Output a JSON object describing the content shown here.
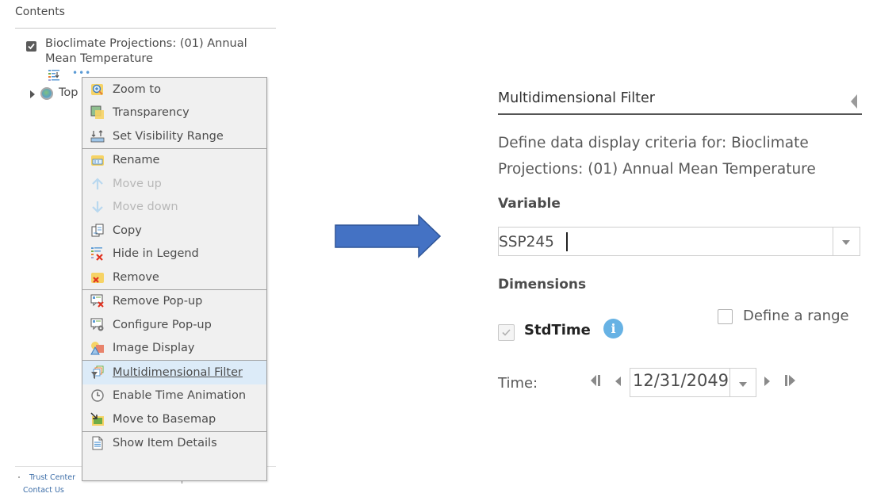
{
  "contents_panel": {
    "title": "Contents",
    "layers": [
      {
        "title": "Bioclimate Projections: (01) Annual Mean Temperature",
        "checked": true,
        "icons": [
          "legend-icon",
          "more-options-icon"
        ]
      },
      {
        "title": "Top",
        "expandable": true,
        "icon": "basemap-globe-icon"
      }
    ],
    "footer": {
      "trust_center": "Trust Center",
      "contact_us": "Contact Us"
    }
  },
  "context_menu": {
    "groups": [
      [
        {
          "label": "Zoom to",
          "icon": "zoom-to-icon",
          "disabled": false
        },
        {
          "label": "Transparency",
          "icon": "transparency-icon",
          "disabled": false
        },
        {
          "label": "Set Visibility Range",
          "icon": "visibility-range-icon",
          "disabled": false
        }
      ],
      [
        {
          "label": "Rename",
          "icon": "rename-icon",
          "disabled": false
        },
        {
          "label": "Move up",
          "icon": "arrow-up-icon",
          "disabled": true
        },
        {
          "label": "Move down",
          "icon": "arrow-down-icon",
          "disabled": true
        },
        {
          "label": "Copy",
          "icon": "copy-icon",
          "disabled": false
        },
        {
          "label": "Hide in Legend",
          "icon": "hide-legend-icon",
          "disabled": false
        },
        {
          "label": "Remove",
          "icon": "remove-icon",
          "disabled": false
        }
      ],
      [
        {
          "label": "Remove Pop-up",
          "icon": "remove-popup-icon",
          "disabled": false
        },
        {
          "label": "Configure Pop-up",
          "icon": "configure-popup-icon",
          "disabled": false
        },
        {
          "label": "Image Display",
          "icon": "image-display-icon",
          "disabled": false
        }
      ],
      [
        {
          "label": "Multidimensional Filter",
          "icon": "multidimensional-filter-icon",
          "disabled": false,
          "active": true
        },
        {
          "label": "Enable Time Animation",
          "icon": "clock-icon",
          "disabled": false
        },
        {
          "label": "Move to Basemap",
          "icon": "move-to-basemap-icon",
          "disabled": false
        }
      ],
      [
        {
          "label": "Show Item Details",
          "icon": "item-details-icon",
          "disabled": false
        }
      ]
    ]
  },
  "arrow": {
    "icon": "right-arrow-icon",
    "color": "#4472c4"
  },
  "filter_panel": {
    "title": "Multidimensional Filter",
    "description": "Define data display criteria for: Bioclimate Projections: (01) Annual Mean Temperature",
    "variable_label": "Variable",
    "variable_value": "SSP245",
    "dimensions_label": "Dimensions",
    "define_range_label": "Define a range",
    "define_range_checked": false,
    "dimension_name": "StdTime",
    "dimension_checked": true,
    "time_label": "Time:",
    "time_value": "12/31/2049"
  },
  "colors": {
    "menu_bg": "#f0f0f0",
    "menu_active": "#dcebf8",
    "info_icon": "#67b2e4",
    "link": "#3d6ea8"
  }
}
